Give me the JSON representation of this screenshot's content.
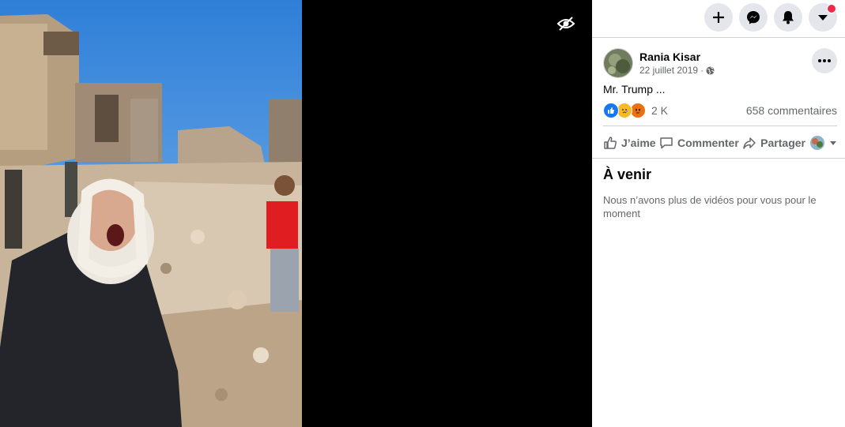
{
  "video": {
    "visibility_toggle_icon": "eye-slash-icon"
  },
  "topbar": {
    "create_icon": "plus-icon",
    "messenger_icon": "messenger-icon",
    "notifications_icon": "bell-icon",
    "account_icon": "caret-down-icon",
    "notification_dot_color": "#f02849"
  },
  "post": {
    "author": "Rania Kisar",
    "date": "22 juillet 2019",
    "separator": "·",
    "privacy_icon": "globe-icon",
    "text": "Mr. Trump ...",
    "reaction_icons": [
      "like-icon",
      "sad-icon",
      "angry-icon"
    ],
    "reaction_count": "2 K",
    "comments_count": "658 commentaires"
  },
  "actions": {
    "like_label": "J’aime",
    "comment_label": "Commenter",
    "share_label": "Partager"
  },
  "upcoming": {
    "title": "À venir",
    "message": "Nous n’avons plus de vidéos pour vous pour le moment"
  },
  "colors": {
    "accent": "#1877f2",
    "secondary_text": "#65676b",
    "button_bg": "#e4e6eb"
  }
}
